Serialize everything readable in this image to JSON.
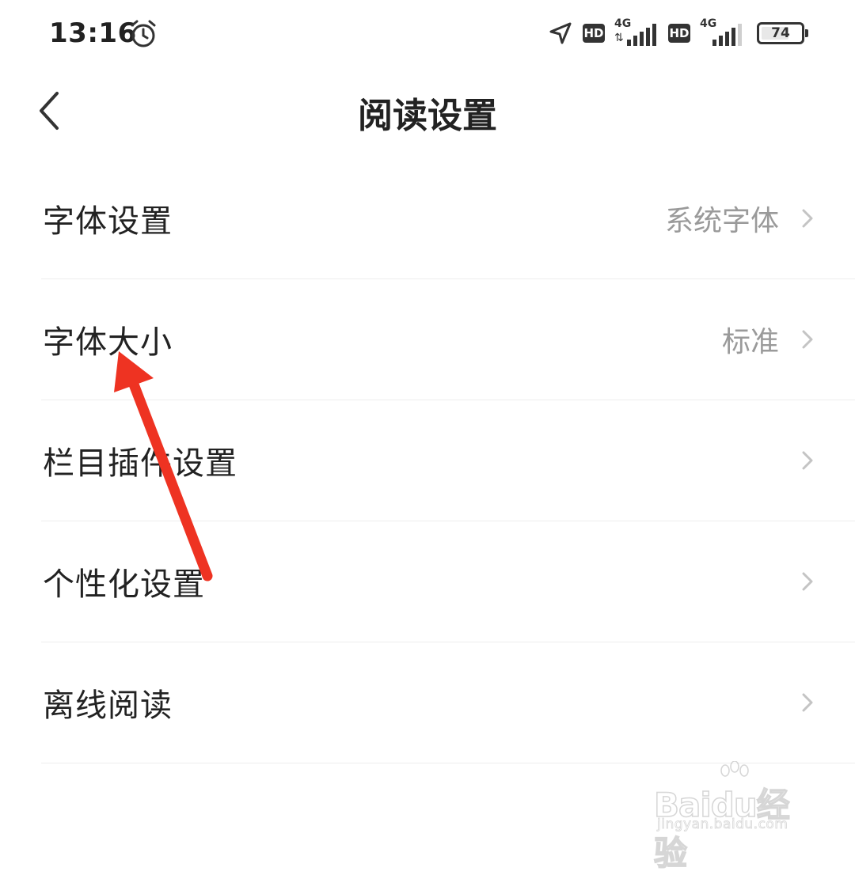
{
  "status_bar": {
    "time": "13:16",
    "hd_label": "HD",
    "network_label": "4G",
    "battery_level": "74",
    "icons": [
      "alarm-icon",
      "location-icon",
      "hd-icon",
      "signal-icon",
      "battery-icon"
    ]
  },
  "header": {
    "title": "阅读设置",
    "back_icon": "chevron-left-icon"
  },
  "settings": {
    "items": [
      {
        "label": "字体设置",
        "value": "系统字体"
      },
      {
        "label": "字体大小",
        "value": "标准"
      },
      {
        "label": "栏目插件设置",
        "value": ""
      },
      {
        "label": "个性化设置",
        "value": ""
      },
      {
        "label": "离线阅读",
        "value": ""
      }
    ]
  },
  "annotation": {
    "type": "arrow",
    "color": "#ee3322",
    "target": "字体大小"
  },
  "watermark": {
    "logo": "Baidu经验",
    "url": "jingyan.baidu.com"
  },
  "colors": {
    "background": "#ffffff",
    "text_primary": "#222222",
    "text_secondary": "#9a9a9a",
    "divider": "#ededed",
    "chevron": "#c4c4c4"
  }
}
